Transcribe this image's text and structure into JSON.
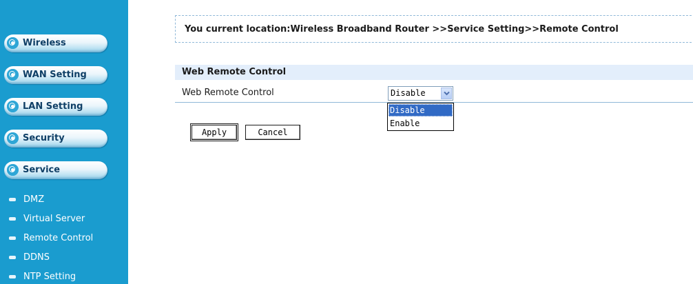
{
  "sidebar": {
    "menu": [
      {
        "label": "Wireless"
      },
      {
        "label": "WAN Setting"
      },
      {
        "label": "LAN Setting"
      },
      {
        "label": "Security"
      },
      {
        "label": "Service"
      }
    ],
    "submenu": [
      {
        "label": "DMZ"
      },
      {
        "label": "Virtual Server"
      },
      {
        "label": "Remote Control"
      },
      {
        "label": "DDNS"
      },
      {
        "label": "NTP Setting"
      }
    ]
  },
  "location": {
    "text": "You current location:Wireless Broadband Router >>Service Setting>>Remote Control"
  },
  "section": {
    "title": "Web Remote Control",
    "field_label": "Web Remote Control",
    "select_value": "Disable",
    "options": [
      "Disable",
      "Enable"
    ]
  },
  "buttons": {
    "apply": "Apply",
    "cancel": "Cancel"
  },
  "colors": {
    "sidebar_bg": "#1a9ccf",
    "header_bg": "#e3eefb",
    "selected_option": "#316ac5"
  }
}
